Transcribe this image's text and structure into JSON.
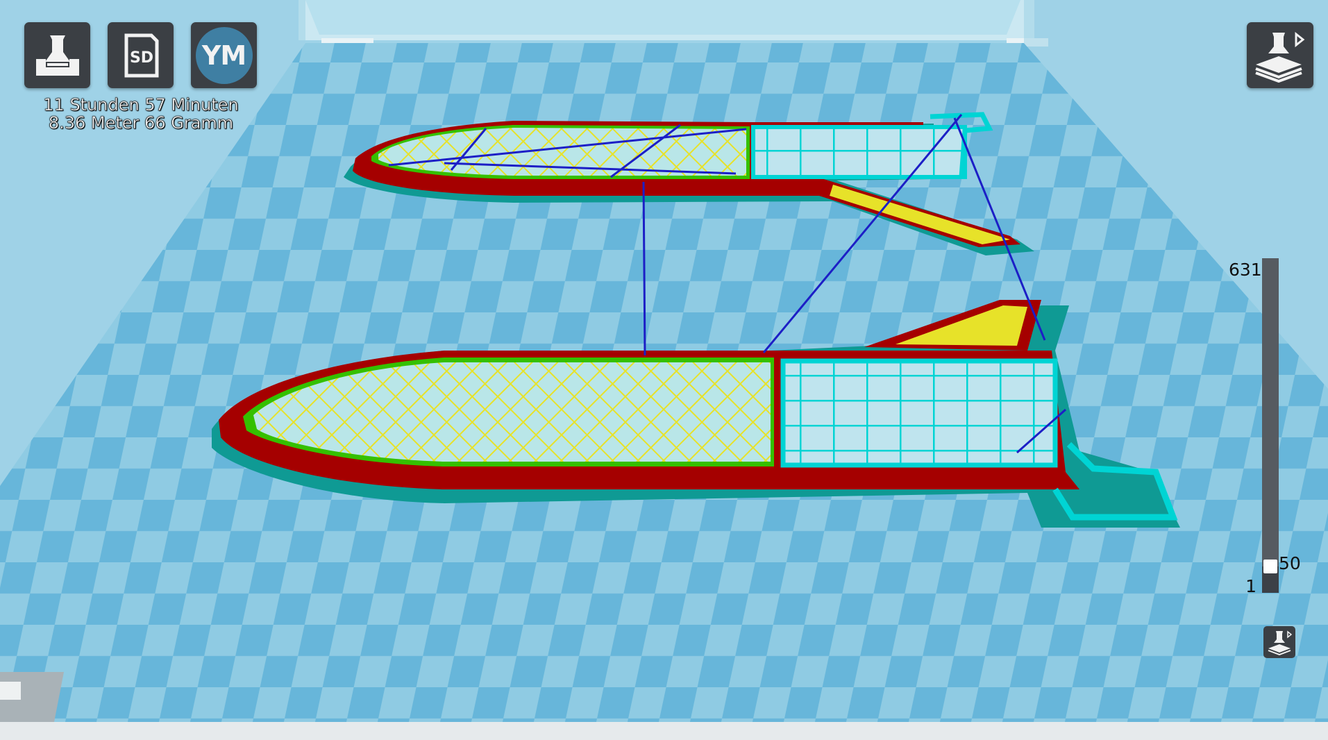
{
  "toolbar": {
    "print_button_icon": "printer-tray-icon",
    "sd_button_label": "SD",
    "ym_button_label": "YM",
    "ym_color": "#3f7fa3"
  },
  "print_info": {
    "time": "11 Stunden 57 Minuten",
    "usage": "8.36 Meter 66 Gramm"
  },
  "view_button_icon": "layer-view-icon",
  "layer_slider": {
    "max": "631",
    "min": "1",
    "current": "50",
    "current_fraction": 0.079
  },
  "colors": {
    "bed_light": "#8fcbe3",
    "bed_dark": "#67b6da",
    "wall_outer": "#a50000",
    "wall_inner": "#35c000",
    "infill": "#e7e229",
    "skin": "#00d4d4",
    "skirt": "#0f9a94",
    "travel": "#1c1fc6",
    "button_bg": "#3b3f44"
  }
}
